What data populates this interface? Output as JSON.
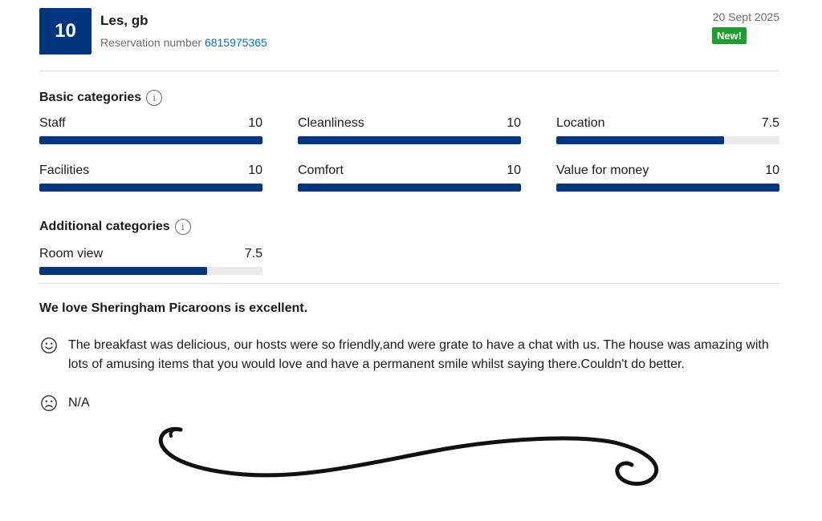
{
  "header": {
    "score": "10",
    "guest_name": "Les, gb",
    "reservation_label": "Reservation number",
    "reservation_number": "6815975365",
    "date": "20 Sept 2025",
    "badge": "New!"
  },
  "basic_categories": {
    "title": "Basic categories",
    "items": [
      {
        "label": "Staff",
        "value": "10",
        "fraction": 1.0
      },
      {
        "label": "Cleanliness",
        "value": "10",
        "fraction": 1.0
      },
      {
        "label": "Location",
        "value": "7.5",
        "fraction": 0.75
      },
      {
        "label": "Facilities",
        "value": "10",
        "fraction": 1.0
      },
      {
        "label": "Comfort",
        "value": "10",
        "fraction": 1.0
      },
      {
        "label": "Value for money",
        "value": "10",
        "fraction": 1.0
      }
    ]
  },
  "additional_categories": {
    "title": "Additional categories",
    "items": [
      {
        "label": "Room view",
        "value": "7.5",
        "fraction": 0.75
      }
    ]
  },
  "review": {
    "headline": "We love Sheringham Picaroons is excellent.",
    "positive": "The breakfast was delicious, our hosts were so friendly,and were grate to have a chat with us. The house was amazing with lots of amusing items that you would love and have a permanent smile whilst saying there.Couldn't do better.",
    "negative": "N/A"
  },
  "icons": {
    "info": "info-icon",
    "positive": "smiley-icon",
    "negative": "sad-face-icon"
  },
  "colors": {
    "brand_blue": "#003580",
    "link_blue": "#0071c2",
    "new_badge_green": "#1e9e2f"
  }
}
